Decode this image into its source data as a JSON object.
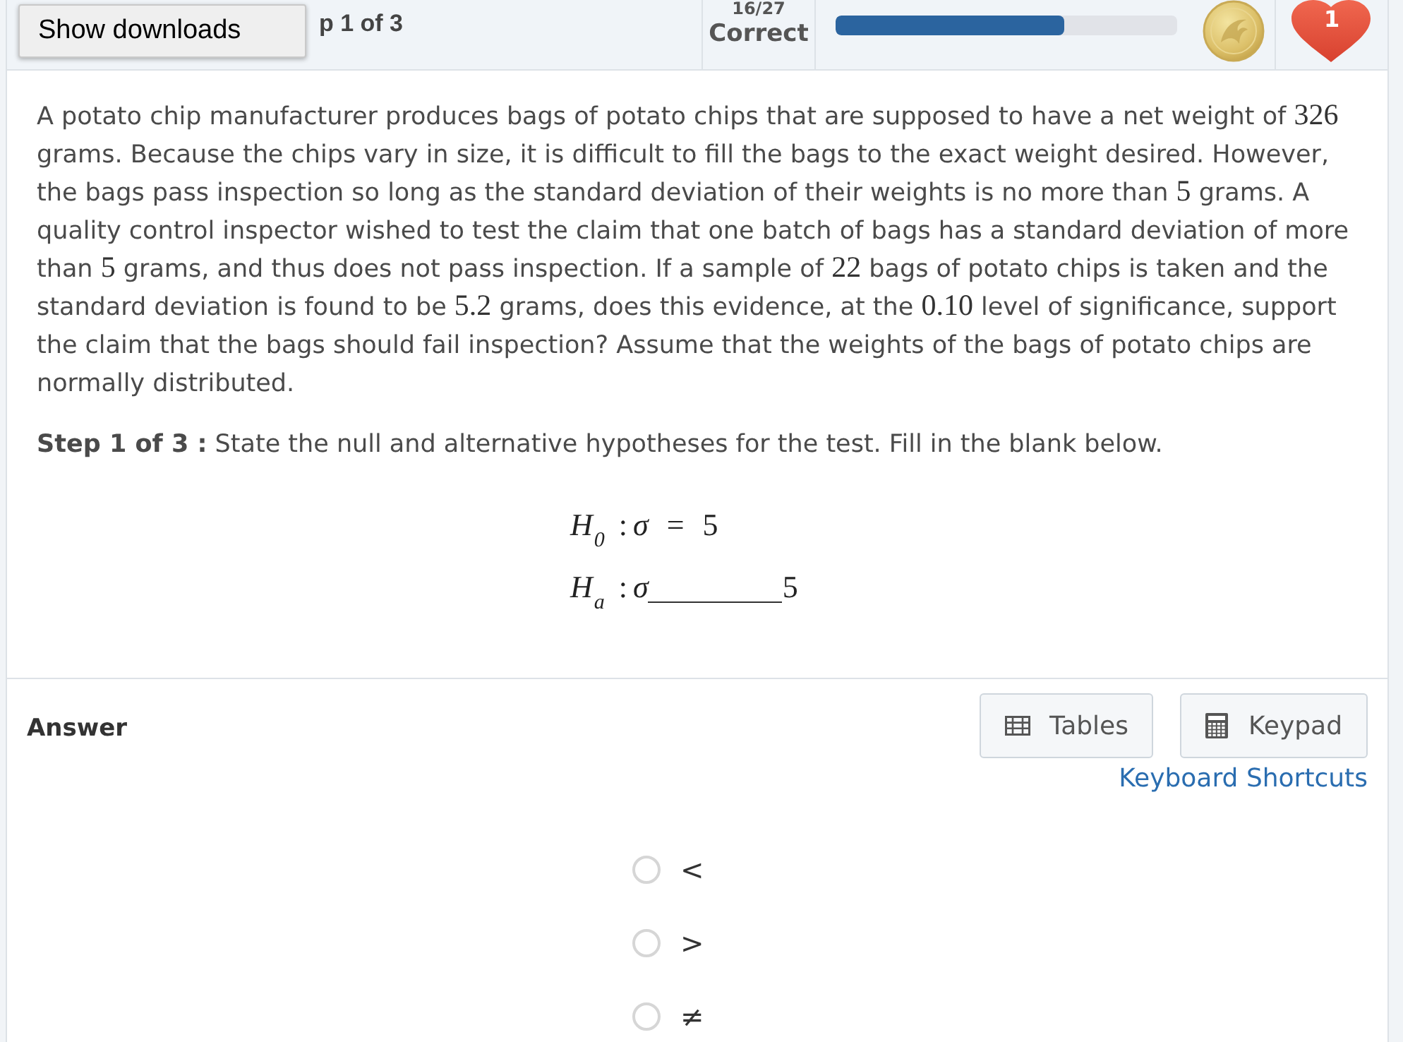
{
  "overlay_button": {
    "label": "Show downloads"
  },
  "header": {
    "step_label": "p 1 of 3",
    "score": "16/27",
    "score_label": "Correct",
    "progress": {
      "level": 0.67
    },
    "lives": "1"
  },
  "question": {
    "segments": [
      {
        "kind": "text",
        "text": "A potato chip manufacturer produces bags of potato chips that are supposed to have a net weight of "
      },
      {
        "kind": "math",
        "text": "326"
      },
      {
        "kind": "text",
        "text": " grams. Because the chips vary in size, it is difficult to fill the bags to the exact weight desired. However, the bags pass inspection so long as the standard deviation of their weights is no more than "
      },
      {
        "kind": "math",
        "text": "5"
      },
      {
        "kind": "text",
        "text": " grams. A quality control inspector wished to test the claim that one batch of bags has a standard deviation of more than "
      },
      {
        "kind": "math",
        "text": "5"
      },
      {
        "kind": "text",
        "text": " grams, and thus does not pass inspection. If a sample of "
      },
      {
        "kind": "math",
        "text": "22"
      },
      {
        "kind": "text",
        "text": " bags of potato chips is taken and the standard deviation is found to be "
      },
      {
        "kind": "math",
        "text": "5.2"
      },
      {
        "kind": "text",
        "text": " grams, does this evidence, at the "
      },
      {
        "kind": "math",
        "text": "0.10"
      },
      {
        "kind": "text",
        "text": " level of significance, support the claim that the bags should fail inspection? Assume that the weights of the bags of potato chips are normally distributed."
      }
    ],
    "step": "**Step 1 of 3 :** State the null and alternative hypotheses for the test. Fill in the blank below.",
    "hypotheses": [
      {
        "kind": "equation",
        "symbol": "H",
        "subscript": "0",
        "separator": ":",
        "parameter": "σ",
        "relation": "=",
        "value": "5"
      },
      {
        "kind": "blank",
        "symbol": "H",
        "subscript": "a",
        "separator": ":",
        "parameter": "σ",
        "value": "5"
      }
    ]
  },
  "answer": {
    "title": "Answer",
    "tools": [
      {
        "kind": "table",
        "label": "Tables"
      },
      {
        "kind": "keypad",
        "label": "Keypad"
      }
    ],
    "shortcuts_link": "Keyboard Shortcuts",
    "options": [
      {
        "label": "<",
        "selected": false
      },
      {
        "label": ">",
        "selected": false
      },
      {
        "label": "≠",
        "selected": false
      }
    ]
  }
}
